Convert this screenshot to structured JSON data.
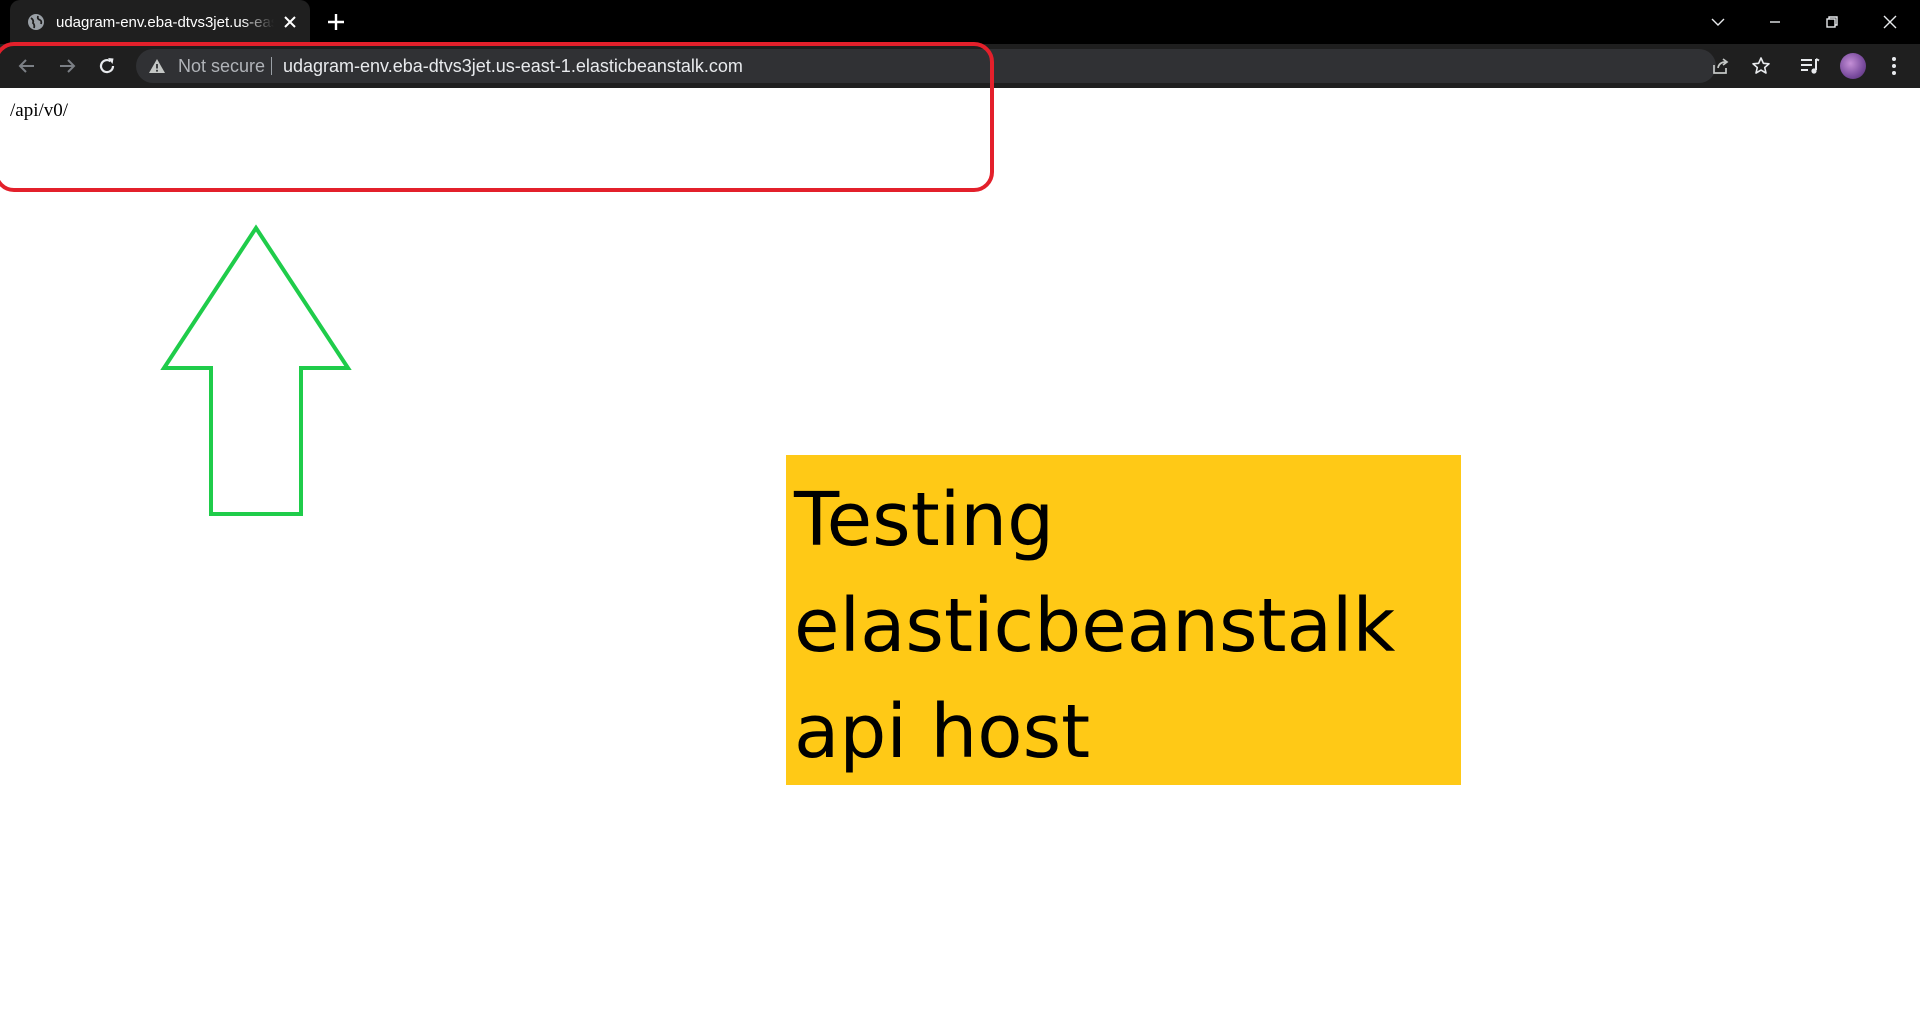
{
  "browser": {
    "tab_title": "udagram-env.eba-dtvs3jet.us-east-1.elasticbeanstalk.com",
    "security_label": "Not secure",
    "url": "udagram-env.eba-dtvs3jet.us-east-1.elasticbeanstalk.com"
  },
  "page": {
    "body_text": "/api/v0/"
  },
  "annotation": {
    "callout_lines": [
      "Testing",
      "elasticbeanstalk",
      "api host"
    ],
    "highlight_color": "#ffc916",
    "box_color": "#e3202b",
    "arrow_color": "#1fcc4a"
  },
  "icons": {
    "favicon": "globe-icon",
    "tab_close": "close-icon",
    "new_tab": "plus-icon",
    "tab_search": "chevron-down-icon",
    "minimize": "minimize-icon",
    "restore": "restore-icon",
    "close_window": "close-icon",
    "back": "arrow-left-icon",
    "forward": "arrow-right-icon",
    "reload": "reload-icon",
    "warning": "warning-icon",
    "share": "share-icon",
    "bookmark": "star-icon",
    "media": "media-queue-icon",
    "profile": "avatar",
    "menu": "kebab-menu-icon"
  }
}
